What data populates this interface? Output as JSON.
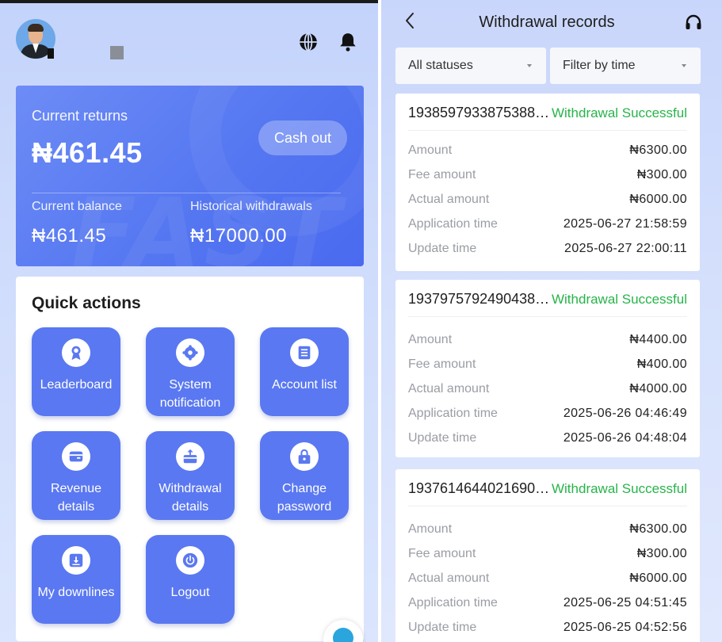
{
  "left": {
    "returns": {
      "label": "Current returns",
      "value": "₦461.45",
      "cashout_label": "Cash out",
      "balance_label": "Current balance",
      "balance_value": "₦461.45",
      "historical_label": "Historical withdrawals",
      "historical_value": "₦17000.00"
    },
    "quick_actions": {
      "title": "Quick actions",
      "items": [
        {
          "label": "Leaderboard",
          "icon": "medal-icon"
        },
        {
          "label": "System notification",
          "icon": "gear-icon"
        },
        {
          "label": "Account list",
          "icon": "list-icon"
        },
        {
          "label": "Revenue details",
          "icon": "wallet-icon"
        },
        {
          "label": "Withdrawal details",
          "icon": "withdraw-icon"
        },
        {
          "label": "Change password",
          "icon": "lock-icon"
        },
        {
          "label": "My downlines",
          "icon": "download-icon"
        },
        {
          "label": "Logout",
          "icon": "power-icon"
        }
      ]
    },
    "colors": {
      "accent": "#5a78f1",
      "card": "#5577f1"
    }
  },
  "right": {
    "title": "Withdrawal records",
    "filters": {
      "status": "All statuses",
      "time": "Filter by time"
    },
    "records": [
      {
        "order_id": "1938597933875388…",
        "status": "Withdrawal Successful",
        "amount_label": "Amount",
        "amount": "₦6300.00",
        "fee_label": "Fee amount",
        "fee": "₦300.00",
        "actual_label": "Actual amount",
        "actual": "₦6000.00",
        "app_time_label": "Application time",
        "app_time": "2025-06-27 21:58:59",
        "update_label": "Update time",
        "update_time": "2025-06-27 22:00:11"
      },
      {
        "order_id": "1937975792490438…",
        "status": "Withdrawal Successful",
        "amount_label": "Amount",
        "amount": "₦4400.00",
        "fee_label": "Fee amount",
        "fee": "₦400.00",
        "actual_label": "Actual amount",
        "actual": "₦4000.00",
        "app_time_label": "Application time",
        "app_time": "2025-06-26 04:46:49",
        "update_label": "Update time",
        "update_time": "2025-06-26 04:48:04"
      },
      {
        "order_id": "1937614644021690…",
        "status": "Withdrawal Successful",
        "amount_label": "Amount",
        "amount": "₦6300.00",
        "fee_label": "Fee amount",
        "fee": "₦300.00",
        "actual_label": "Actual amount",
        "actual": "₦6000.00",
        "app_time_label": "Application time",
        "app_time": "2025-06-25 04:51:45",
        "update_label": "Update time",
        "update_time": "2025-06-25 04:52:56"
      }
    ],
    "colors": {
      "success": "#27b44a"
    }
  }
}
